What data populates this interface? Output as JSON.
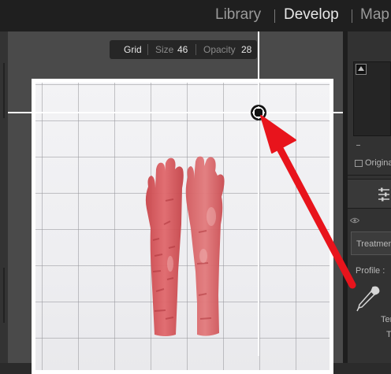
{
  "modules": {
    "library": "Library",
    "develop": "Develop",
    "map": "Map"
  },
  "grid_overlay": {
    "title": "Grid",
    "size_label": "Size",
    "size_value": "46",
    "opacity_label": "Opacity",
    "opacity_value": "28"
  },
  "right_panel": {
    "original_label": "Origina",
    "treatment_label": "Treatmen",
    "profile_label": "Profile :",
    "temp_label": "Ter",
    "tint_label": "T"
  },
  "colors": {
    "annotation_arrow": "#e8141c",
    "guide_lines": "#ffffff",
    "active_module": "#e8e8e8"
  },
  "icons": [
    "grid-handle-icon",
    "histogram-clipping-icon",
    "basic-sliders-icon",
    "visibility-eye-icon",
    "white-balance-eyedropper-icon"
  ]
}
